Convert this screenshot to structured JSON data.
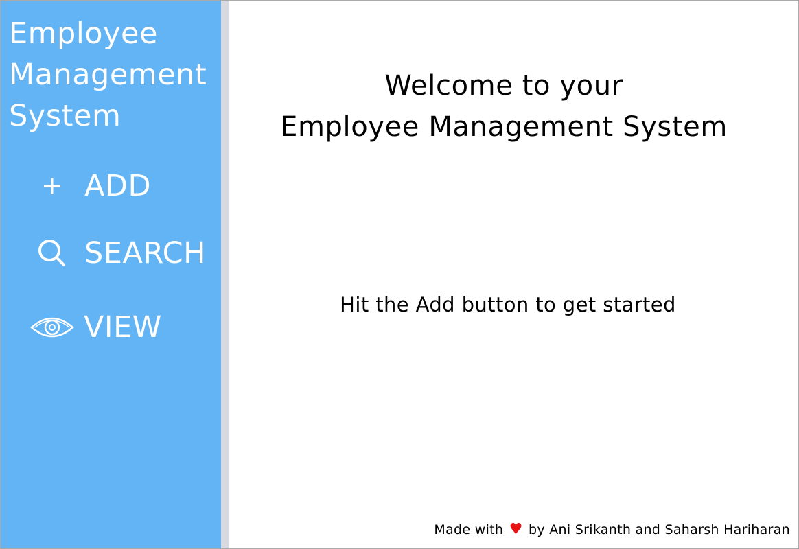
{
  "sidebar": {
    "app_title": "Employee\nManagement\nSystem",
    "items": [
      {
        "label": "ADD",
        "icon": "plus-icon"
      },
      {
        "label": "SEARCH",
        "icon": "search-icon"
      },
      {
        "label": "VIEW",
        "icon": "eye-icon"
      }
    ]
  },
  "main": {
    "welcome_line1": "Welcome to your",
    "welcome_line2": "Employee Management System",
    "hint": "Hit the Add button to get started"
  },
  "footer": {
    "prefix": "Made with",
    "heart": "♥",
    "suffix": "by Ani Srikanth and Saharsh Hariharan"
  },
  "colors": {
    "sidebar": "#63b4f5",
    "divider": "#d9d9e1",
    "heart": "#e81212"
  }
}
